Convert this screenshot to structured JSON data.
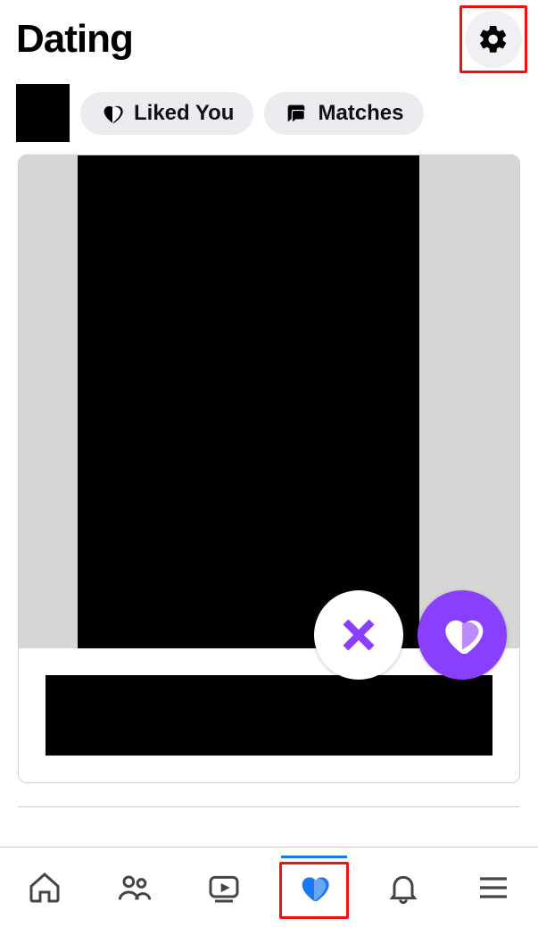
{
  "header": {
    "title": "Dating"
  },
  "chips": {
    "liked_you": "Liked You",
    "matches": "Matches"
  },
  "colors": {
    "accent_purple": "#8a3ffc",
    "fb_blue": "#1877f2",
    "highlight_red": "#e11"
  },
  "tabs": [
    {
      "name": "home",
      "active": false
    },
    {
      "name": "friends",
      "active": false
    },
    {
      "name": "watch",
      "active": false
    },
    {
      "name": "dating",
      "active": true
    },
    {
      "name": "notifications",
      "active": false
    },
    {
      "name": "menu",
      "active": false
    }
  ]
}
